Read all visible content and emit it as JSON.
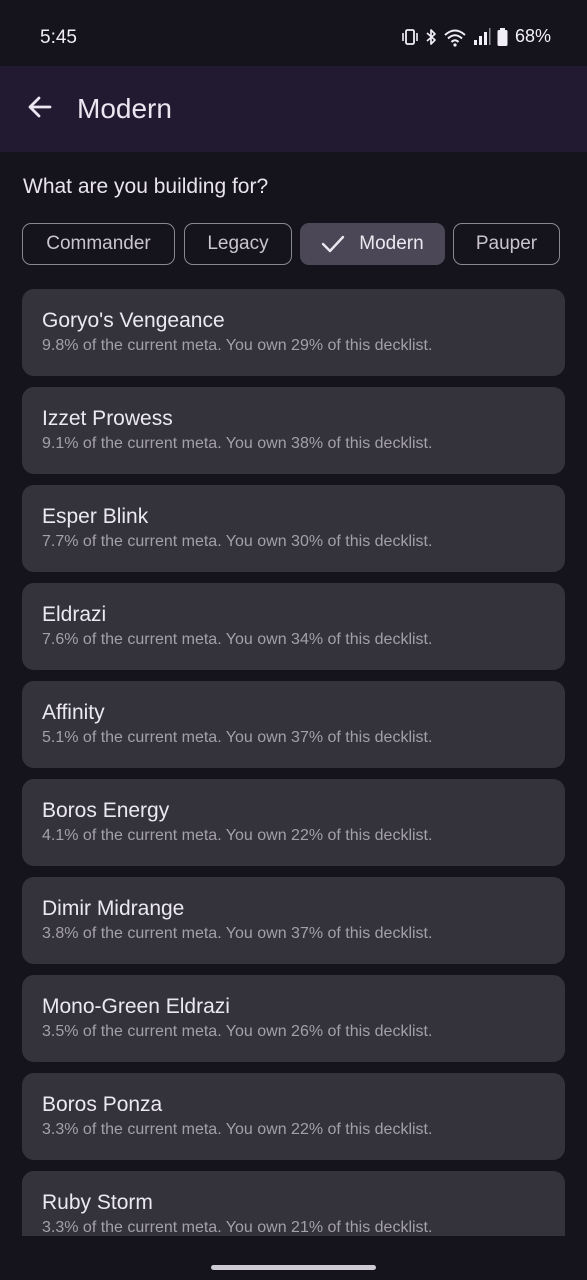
{
  "status_bar": {
    "time": "5:45",
    "battery": "68%",
    "icons": [
      "vibrate-icon",
      "bluetooth-icon",
      "wifi-icon",
      "signal-icon",
      "battery-icon"
    ]
  },
  "app_bar": {
    "back_icon": "arrow-left-icon",
    "title": "Modern"
  },
  "prompt": "What are you building for?",
  "formats": [
    {
      "label": "Commander",
      "selected": false
    },
    {
      "label": "Legacy",
      "selected": false
    },
    {
      "label": "Modern",
      "selected": true
    },
    {
      "label": "Pauper",
      "selected": false
    }
  ],
  "decks": [
    {
      "name": "Goryo's Vengeance",
      "detail": "9.8% of the current meta. You own 29% of this decklist."
    },
    {
      "name": "Izzet Prowess",
      "detail": "9.1% of the current meta. You own 38% of this decklist."
    },
    {
      "name": "Esper Blink",
      "detail": "7.7% of the current meta. You own 30% of this decklist."
    },
    {
      "name": "Eldrazi",
      "detail": "7.6% of the current meta. You own 34% of this decklist."
    },
    {
      "name": "Affinity",
      "detail": "5.1% of the current meta. You own 37% of this decklist."
    },
    {
      "name": "Boros Energy",
      "detail": "4.1% of the current meta. You own 22% of this decklist."
    },
    {
      "name": "Dimir Midrange",
      "detail": "3.8% of the current meta. You own 37% of this decklist."
    },
    {
      "name": "Mono-Green Eldrazi",
      "detail": "3.5% of the current meta. You own 26% of this decklist."
    },
    {
      "name": "Boros Ponza",
      "detail": "3.3% of the current meta. You own 22% of this decklist."
    },
    {
      "name": "Ruby Storm",
      "detail": "3.3% of the current meta. You own 21% of this decklist."
    }
  ],
  "colors": {
    "background": "#15131c",
    "app_bar": "#221a31",
    "card": "#34333c",
    "chip_selected": "#4b4756"
  }
}
